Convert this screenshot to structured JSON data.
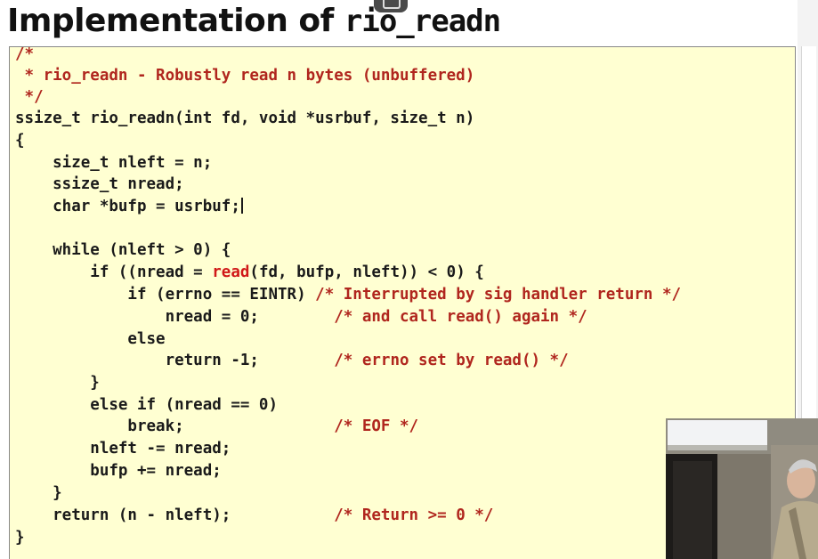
{
  "slide": {
    "title_prefix": "Implementation of ",
    "title_code": "rio_readn"
  },
  "code": {
    "lines": [
      [
        {
          "t": "/*",
          "c": "cm"
        }
      ],
      [
        {
          "t": " * rio_readn - Robustly read n bytes (unbuffered)",
          "c": "cm"
        }
      ],
      [
        {
          "t": " */",
          "c": "cm"
        }
      ],
      [
        {
          "t": "ssize_t rio_readn(int fd, void *usrbuf, size_t n)",
          "c": ""
        }
      ],
      [
        {
          "t": "{",
          "c": ""
        }
      ],
      [
        {
          "t": "    size_t nleft = n;",
          "c": ""
        }
      ],
      [
        {
          "t": "    ssize_t nread;",
          "c": ""
        }
      ],
      [
        {
          "t": "    char *bufp = usrbuf;",
          "c": ""
        }
      ],
      [
        {
          "t": "",
          "c": ""
        }
      ],
      [
        {
          "t": "    while (nleft > 0) {",
          "c": ""
        }
      ],
      [
        {
          "t": "        if ((nread = ",
          "c": ""
        },
        {
          "t": "read",
          "c": "kw-red"
        },
        {
          "t": "(fd, bufp, nleft)) < 0) {",
          "c": ""
        }
      ],
      [
        {
          "t": "            if (errno == EINTR) ",
          "c": ""
        },
        {
          "t": "/* Interrupted by sig handler return */",
          "c": "cm"
        }
      ],
      [
        {
          "t": "                nread = 0;        ",
          "c": ""
        },
        {
          "t": "/* and call read() again */",
          "c": "cm"
        }
      ],
      [
        {
          "t": "            else",
          "c": ""
        }
      ],
      [
        {
          "t": "                return -1;        ",
          "c": ""
        },
        {
          "t": "/* errno set by read() */",
          "c": "cm"
        }
      ],
      [
        {
          "t": "        }",
          "c": ""
        }
      ],
      [
        {
          "t": "        else if (nread == 0)",
          "c": ""
        }
      ],
      [
        {
          "t": "            break;                ",
          "c": ""
        },
        {
          "t": "/* EOF */",
          "c": "cm"
        }
      ],
      [
        {
          "t": "        nleft -= nread;",
          "c": ""
        }
      ],
      [
        {
          "t": "        bufp += nread;",
          "c": ""
        }
      ],
      [
        {
          "t": "    }",
          "c": ""
        }
      ],
      [
        {
          "t": "    return (n - nleft);           ",
          "c": ""
        },
        {
          "t": "/* Return >= 0 */",
          "c": "cm"
        }
      ],
      [
        {
          "t": "}",
          "c": ""
        }
      ]
    ],
    "line_tops": [
      60,
      84,
      108,
      132,
      157,
      182,
      206,
      231,
      256,
      280,
      305,
      330,
      355,
      380,
      404,
      429,
      454,
      478,
      503,
      528,
      553,
      578,
      603
    ],
    "cursor_after_line": 7
  },
  "colors": {
    "code_background": "#ffffd2",
    "comment": "#b0261e",
    "highlight": "#d01818"
  }
}
